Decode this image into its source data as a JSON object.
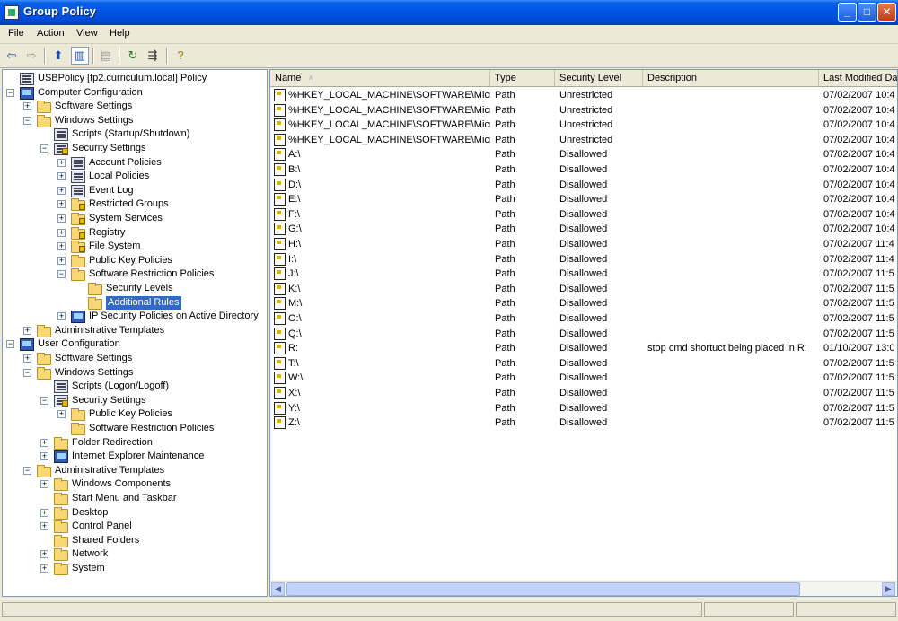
{
  "window": {
    "title": "Group Policy"
  },
  "menu": [
    "File",
    "Action",
    "View",
    "Help"
  ],
  "tree": [
    {
      "label": "USBPolicy [fp2.curriculum.local] Policy",
      "icon": "scroll-icon",
      "level": 0
    },
    {
      "label": "Computer Configuration",
      "icon": "computer-icon",
      "level": 0,
      "exp": "-"
    },
    {
      "label": "Software Settings",
      "icon": "folder-icon",
      "level": 1,
      "exp": "+"
    },
    {
      "label": "Windows Settings",
      "icon": "folder-icon",
      "level": 1,
      "exp": "-"
    },
    {
      "label": "Scripts (Startup/Shutdown)",
      "icon": "script-icon",
      "level": 2
    },
    {
      "label": "Security Settings",
      "icon": "security-icon",
      "level": 2,
      "exp": "-"
    },
    {
      "label": "Account Policies",
      "icon": "policy-icon",
      "level": 3,
      "exp": "+"
    },
    {
      "label": "Local Policies",
      "icon": "policy-icon",
      "level": 3,
      "exp": "+"
    },
    {
      "label": "Event Log",
      "icon": "policy-icon",
      "level": 3,
      "exp": "+"
    },
    {
      "label": "Restricted Groups",
      "icon": "locked-folder-icon",
      "level": 3,
      "exp": "+"
    },
    {
      "label": "System Services",
      "icon": "locked-folder-icon",
      "level": 3,
      "exp": "+"
    },
    {
      "label": "Registry",
      "icon": "locked-folder-icon",
      "level": 3,
      "exp": "+"
    },
    {
      "label": "File System",
      "icon": "locked-folder-icon",
      "level": 3,
      "exp": "+"
    },
    {
      "label": "Public Key Policies",
      "icon": "folder-icon",
      "level": 3,
      "exp": "+"
    },
    {
      "label": "Software Restriction Policies",
      "icon": "folder-icon",
      "level": 3,
      "exp": "-"
    },
    {
      "label": "Security Levels",
      "icon": "folder-icon",
      "level": 4
    },
    {
      "label": "Additional Rules",
      "icon": "open-folder-icon",
      "level": 4,
      "selected": true
    },
    {
      "label": "IP Security Policies on Active Directory",
      "icon": "network-icon",
      "level": 3,
      "exp": "+"
    },
    {
      "label": "Administrative Templates",
      "icon": "folder-icon",
      "level": 1,
      "exp": "+"
    },
    {
      "label": "User Configuration",
      "icon": "user-icon",
      "level": 0,
      "exp": "-"
    },
    {
      "label": "Software Settings",
      "icon": "folder-icon",
      "level": 1,
      "exp": "+"
    },
    {
      "label": "Windows Settings",
      "icon": "folder-icon",
      "level": 1,
      "exp": "-"
    },
    {
      "label": "Scripts (Logon/Logoff)",
      "icon": "script-icon",
      "level": 2
    },
    {
      "label": "Security Settings",
      "icon": "security-icon",
      "level": 2,
      "exp": "-"
    },
    {
      "label": "Public Key Policies",
      "icon": "folder-icon",
      "level": 3,
      "exp": "+"
    },
    {
      "label": "Software Restriction Policies",
      "icon": "folder-icon",
      "level": 3
    },
    {
      "label": "Folder Redirection",
      "icon": "folder-icon",
      "level": 2,
      "exp": "+"
    },
    {
      "label": "Internet Explorer Maintenance",
      "icon": "ie-icon",
      "level": 2,
      "exp": "+"
    },
    {
      "label": "Administrative Templates",
      "icon": "folder-icon",
      "level": 1,
      "exp": "-"
    },
    {
      "label": "Windows Components",
      "icon": "folder-icon",
      "level": 2,
      "exp": "+"
    },
    {
      "label": "Start Menu and Taskbar",
      "icon": "folder-icon",
      "level": 2
    },
    {
      "label": "Desktop",
      "icon": "folder-icon",
      "level": 2,
      "exp": "+"
    },
    {
      "label": "Control Panel",
      "icon": "folder-icon",
      "level": 2,
      "exp": "+"
    },
    {
      "label": "Shared Folders",
      "icon": "folder-icon",
      "level": 2
    },
    {
      "label": "Network",
      "icon": "folder-icon",
      "level": 2,
      "exp": "+"
    },
    {
      "label": "System",
      "icon": "folder-icon",
      "level": 2,
      "exp": "+"
    }
  ],
  "columns": [
    "Name",
    "Type",
    "Security Level",
    "Description",
    "Last Modified Dat"
  ],
  "rows": [
    {
      "name": "%HKEY_LOCAL_MACHINE\\SOFTWARE\\Micro...",
      "type": "Path",
      "level": "Unrestricted",
      "desc": "",
      "date": "07/02/2007 10:4"
    },
    {
      "name": "%HKEY_LOCAL_MACHINE\\SOFTWARE\\Micro...",
      "type": "Path",
      "level": "Unrestricted",
      "desc": "",
      "date": "07/02/2007 10:4"
    },
    {
      "name": "%HKEY_LOCAL_MACHINE\\SOFTWARE\\Micro...",
      "type": "Path",
      "level": "Unrestricted",
      "desc": "",
      "date": "07/02/2007 10:4"
    },
    {
      "name": "%HKEY_LOCAL_MACHINE\\SOFTWARE\\Micro...",
      "type": "Path",
      "level": "Unrestricted",
      "desc": "",
      "date": "07/02/2007 10:4"
    },
    {
      "name": "A:\\",
      "type": "Path",
      "level": "Disallowed",
      "desc": "",
      "date": "07/02/2007 10:4"
    },
    {
      "name": "B:\\",
      "type": "Path",
      "level": "Disallowed",
      "desc": "",
      "date": "07/02/2007 10:4"
    },
    {
      "name": "D:\\",
      "type": "Path",
      "level": "Disallowed",
      "desc": "",
      "date": "07/02/2007 10:4"
    },
    {
      "name": "E:\\",
      "type": "Path",
      "level": "Disallowed",
      "desc": "",
      "date": "07/02/2007 10:4"
    },
    {
      "name": "F:\\",
      "type": "Path",
      "level": "Disallowed",
      "desc": "",
      "date": "07/02/2007 10:4"
    },
    {
      "name": "G:\\",
      "type": "Path",
      "level": "Disallowed",
      "desc": "",
      "date": "07/02/2007 10:4"
    },
    {
      "name": "H:\\",
      "type": "Path",
      "level": "Disallowed",
      "desc": "",
      "date": "07/02/2007 11:4"
    },
    {
      "name": "I:\\",
      "type": "Path",
      "level": "Disallowed",
      "desc": "",
      "date": "07/02/2007 11:4"
    },
    {
      "name": "J:\\",
      "type": "Path",
      "level": "Disallowed",
      "desc": "",
      "date": "07/02/2007 11:5"
    },
    {
      "name": "K:\\",
      "type": "Path",
      "level": "Disallowed",
      "desc": "",
      "date": "07/02/2007 11:5"
    },
    {
      "name": "M:\\",
      "type": "Path",
      "level": "Disallowed",
      "desc": "",
      "date": "07/02/2007 11:5"
    },
    {
      "name": "O:\\",
      "type": "Path",
      "level": "Disallowed",
      "desc": "",
      "date": "07/02/2007 11:5"
    },
    {
      "name": "Q:\\",
      "type": "Path",
      "level": "Disallowed",
      "desc": "",
      "date": "07/02/2007 11:5"
    },
    {
      "name": "R:",
      "type": "Path",
      "level": "Disallowed",
      "desc": "stop cmd shortuct being placed in R:",
      "date": "01/10/2007 13:0"
    },
    {
      "name": "T:\\",
      "type": "Path",
      "level": "Disallowed",
      "desc": "",
      "date": "07/02/2007 11:5"
    },
    {
      "name": "W:\\",
      "type": "Path",
      "level": "Disallowed",
      "desc": "",
      "date": "07/02/2007 11:5"
    },
    {
      "name": "X:\\",
      "type": "Path",
      "level": "Disallowed",
      "desc": "",
      "date": "07/02/2007 11:5"
    },
    {
      "name": "Y:\\",
      "type": "Path",
      "level": "Disallowed",
      "desc": "",
      "date": "07/02/2007 11:5"
    },
    {
      "name": "Z:\\",
      "type": "Path",
      "level": "Disallowed",
      "desc": "",
      "date": "07/02/2007 11:5"
    }
  ]
}
